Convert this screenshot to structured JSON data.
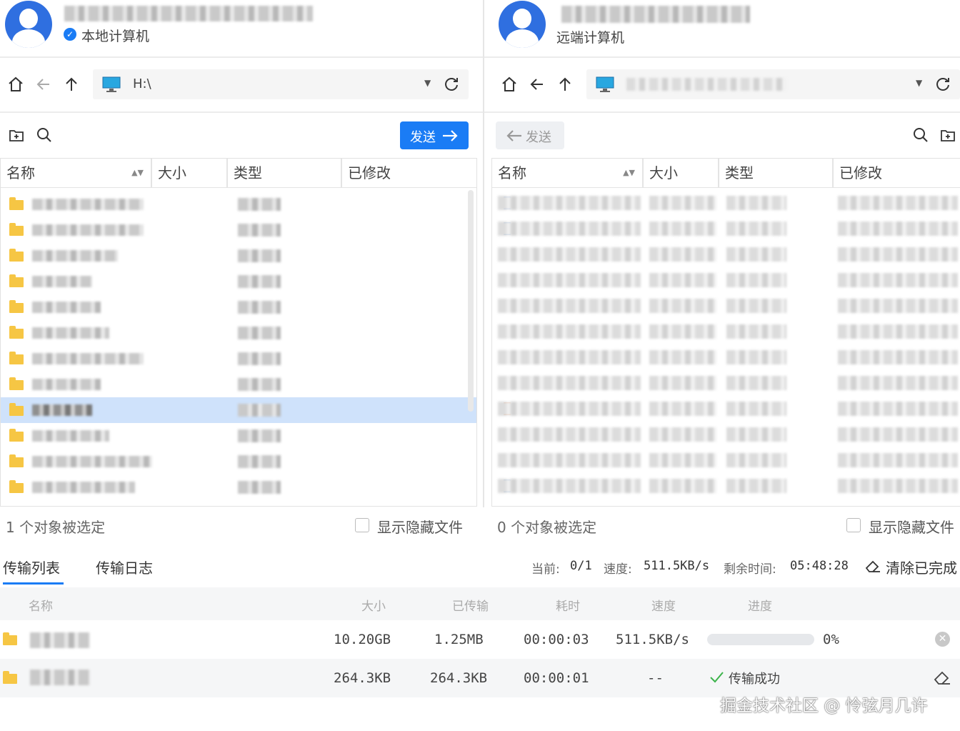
{
  "local": {
    "subtitle": "本地计算机",
    "path": "H:\\",
    "send_label": "发送",
    "columns": [
      "名称",
      "大小",
      "类型",
      "已修改"
    ],
    "status": "1 个对象被选定",
    "show_hidden": "显示隐藏文件"
  },
  "remote": {
    "subtitle": "远端计算机",
    "send_label": "发送",
    "columns": [
      "名称",
      "大小",
      "类型",
      "已修改"
    ],
    "status": "0 个对象被选定",
    "show_hidden": "显示隐藏文件"
  },
  "transfer": {
    "tabs": [
      "传输列表",
      "传输日志"
    ],
    "current_label": "当前:",
    "current_value": "0/1",
    "speed_label": "速度:",
    "speed_value": "511.5KB/s",
    "remaining_label": "剩余时间:",
    "remaining_value": "05:48:28",
    "clear_label": "清除已完成",
    "columns": [
      "名称",
      "大小",
      "已传输",
      "耗时",
      "速度",
      "进度"
    ],
    "rows": [
      {
        "size": "10.20GB",
        "transferred": "1.25MB",
        "elapsed": "00:00:03",
        "speed": "511.5KB/s",
        "progress": "0%",
        "progress_value": 0
      },
      {
        "size": "264.3KB",
        "transferred": "264.3KB",
        "elapsed": "00:00:01",
        "speed": "--",
        "progress": "传输成功"
      }
    ]
  },
  "watermark": "掘金技术社区 @ 怜弦月几许",
  "colors": {
    "accent": "#1a7cf5",
    "selection": "#cfe2fb",
    "folder": "#f6c644"
  }
}
